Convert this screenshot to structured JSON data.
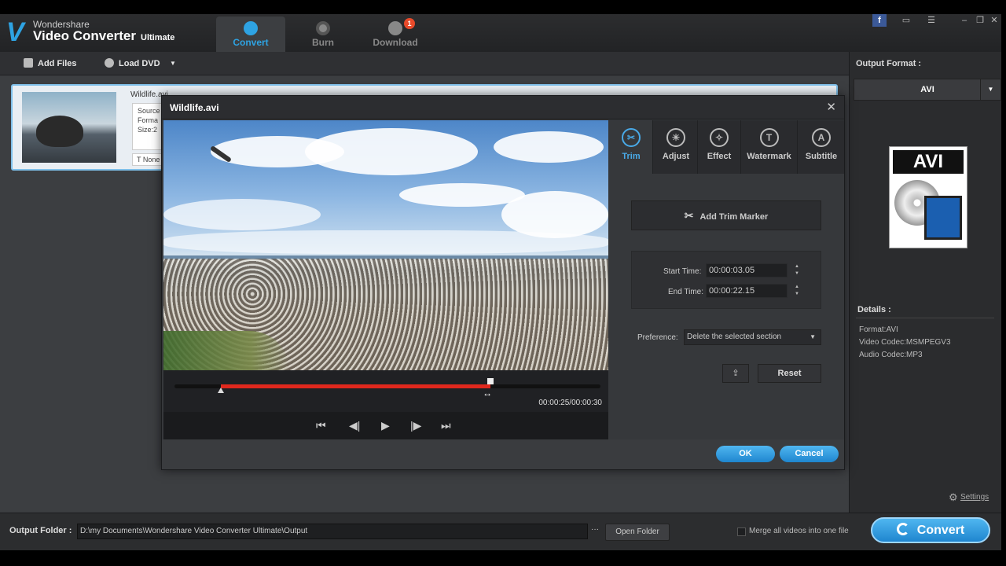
{
  "app": {
    "brand_small": "Wondershare",
    "brand_main": "Video Converter",
    "brand_edition": "Ultimate",
    "logo_letter": "V",
    "accent_color": "#2ea3e3"
  },
  "main_tabs": [
    {
      "label": "Convert",
      "icon": "convert-icon",
      "active": true
    },
    {
      "label": "Burn",
      "icon": "disc-icon",
      "active": false
    },
    {
      "label": "Download",
      "icon": "download-icon",
      "active": false,
      "badge": "1"
    }
  ],
  "window_controls": [
    "facebook-icon",
    "chat-icon",
    "menu-icon",
    "minimize-icon",
    "restore-icon",
    "close-icon"
  ],
  "toolbar": {
    "add_files": "Add Files",
    "load_dvd": "Load DVD"
  },
  "file": {
    "name": "Wildlife.avi",
    "info_lines": [
      "Source",
      "Forma",
      "Size:2"
    ],
    "subtitle": "None"
  },
  "output_format": {
    "label": "Output Format :",
    "selected": "AVI",
    "card_title": "AVI",
    "details_label": "Details :",
    "details": [
      "Format:AVI",
      "Video Codec:MSMPEGV3",
      "Audio Codec:MP3"
    ],
    "settings": "Settings"
  },
  "bottom": {
    "output_folder_label": "Output Folder :",
    "output_folder_path": "D:\\my Documents\\Wondershare Video Converter Ultimate\\Output",
    "browse": "···",
    "open_folder": "Open Folder",
    "merge_label": "Merge all videos into one file",
    "merge_checked": false,
    "convert": "Convert"
  },
  "dialog": {
    "title": "Wildlife.avi",
    "close": "✕",
    "time_readout": "00:00:25/00:00:30",
    "trim_start_fraction": 0.108,
    "trim_end_fraction": 0.742,
    "edit_tabs": [
      {
        "label": "Trim",
        "icon": "scissors-icon",
        "glyph": "✂",
        "active": true
      },
      {
        "label": "Adjust",
        "icon": "adjust-icon",
        "glyph": "☀",
        "active": false
      },
      {
        "label": "Effect",
        "icon": "effect-icon",
        "glyph": "✧",
        "active": false
      },
      {
        "label": "Watermark",
        "icon": "watermark-icon",
        "glyph": "T",
        "active": false
      },
      {
        "label": "Subtitle",
        "icon": "subtitle-icon",
        "glyph": "A",
        "active": false
      }
    ],
    "add_trim_marker": "Add Trim Marker",
    "start_time_label": "Start Time:",
    "start_time": "00:00:03.05",
    "end_time_label": "End Time:",
    "end_time": "00:00:22.15",
    "preference_label": "Preference:",
    "preference_value": "Delete the selected section",
    "reset": "Reset",
    "ok": "OK",
    "cancel": "Cancel",
    "trim_color": "#e0281d"
  }
}
